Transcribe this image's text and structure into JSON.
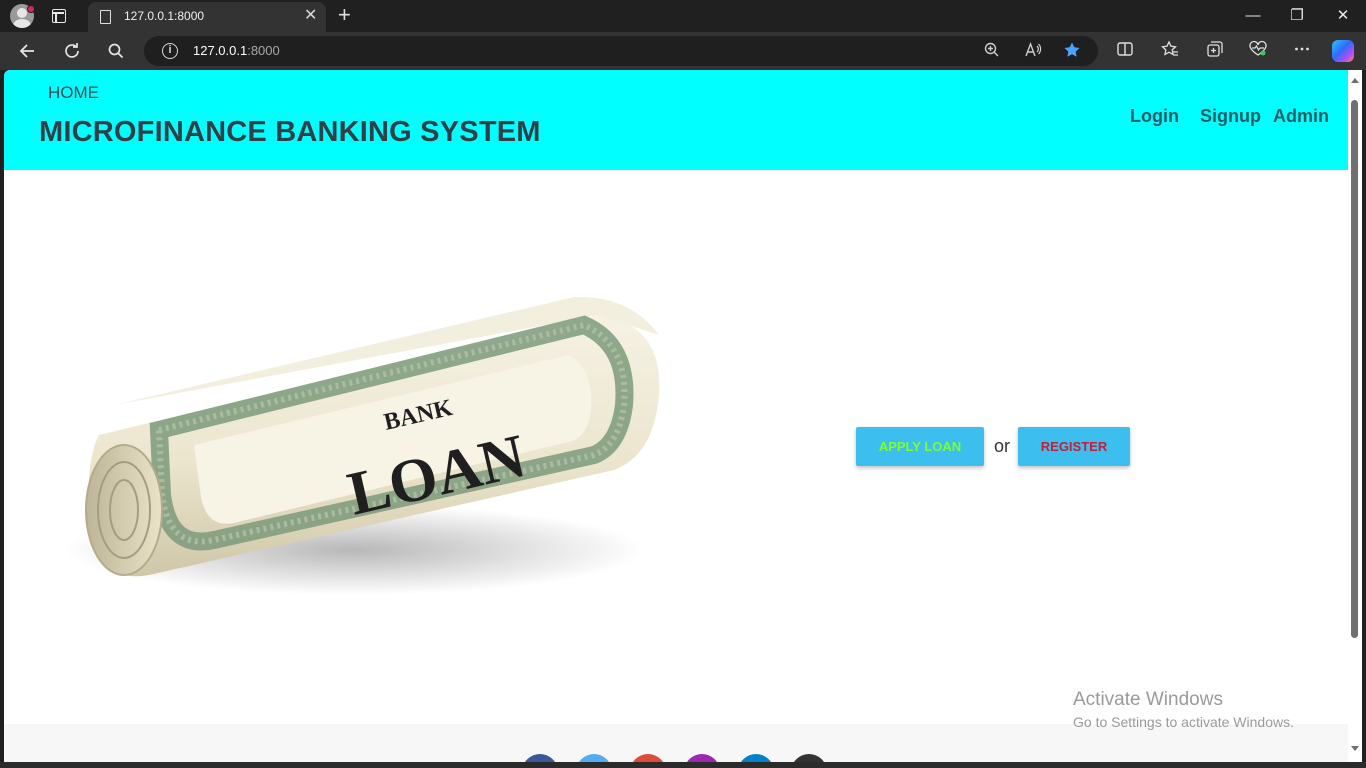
{
  "browser": {
    "tab_title": "127.0.0.1:8000",
    "url_host": "127.0.0.1",
    "url_port": ":8000",
    "new_tab_glyph": "+",
    "close_tab_glyph": "✕",
    "icons": [
      "profile-icon",
      "tab-actions-icon",
      "page-icon",
      "back-icon",
      "refresh-icon",
      "search-icon",
      "info-icon",
      "zoom-icon",
      "read-aloud-icon",
      "favorite-star-icon",
      "split-screen-icon",
      "favorites-icon",
      "collections-icon",
      "performance-icon",
      "more-icon",
      "copilot-icon"
    ],
    "window_controls": {
      "minimize": "—",
      "restore": "❐",
      "close": "✕"
    }
  },
  "header": {
    "home_link": "HOME",
    "title": "MICROFINANCE BANKING SYSTEM",
    "nav": {
      "login": "Login",
      "signup": "Signup",
      "admin": "Admin"
    },
    "bg_color": "#00ffff"
  },
  "hero": {
    "image_text_top": "BANK",
    "image_text_main": "LOAN",
    "apply_button": "APPLY LOAN",
    "or_text": "or",
    "register_button": "REGISTER",
    "button_color": "#3cbfef"
  },
  "social_colors": [
    "#3b5998",
    "#55acee",
    "#dd4b39",
    "#9c27b0",
    "#0082ca",
    "#333333"
  ],
  "watermark": {
    "title": "Activate Windows",
    "subtitle": "Go to Settings to activate Windows."
  }
}
